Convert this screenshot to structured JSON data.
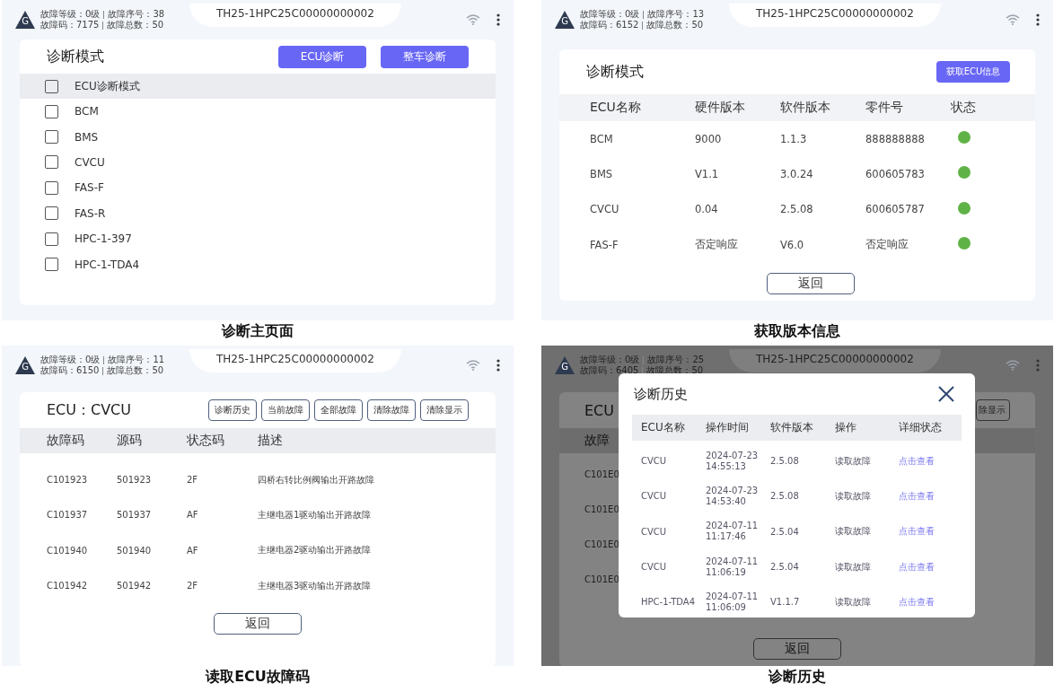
{
  "panels": [
    {
      "kind": "ecu_select",
      "caption": "诊断主页面",
      "status": {
        "logo": "G",
        "fault_level": "故障等级：0级",
        "fault_seq": "故障序号：38",
        "fault_code": "故障码：7175",
        "fault_total": "故障总数：50",
        "device": "TH25-1HPC25C00000000002"
      },
      "title": "诊断模式",
      "buttons": [
        "ECU诊断",
        "整车诊断"
      ],
      "header_checkbox": {
        "label": "ECU诊断模式",
        "checked": false
      },
      "items": [
        {
          "label": "BCM",
          "checked": false
        },
        {
          "label": "BMS",
          "checked": false
        },
        {
          "label": "CVCU",
          "checked": false
        },
        {
          "label": "FAS-F",
          "checked": false
        },
        {
          "label": "FAS-R",
          "checked": false
        },
        {
          "label": "HPC-1-397",
          "checked": false
        },
        {
          "label": "HPC-1-TDA4",
          "checked": false
        }
      ]
    },
    {
      "kind": "version_info",
      "caption": "获取版本信息",
      "status": {
        "logo": "G",
        "fault_level": "故障等级：0级",
        "fault_seq": "故障序号：13",
        "fault_code": "故障码：6152",
        "fault_total": "故障总数：50",
        "device": "TH25-1HPC25C00000000002"
      },
      "title": "诊断模式",
      "button": "获取ECU信息",
      "columns": [
        "ECU名称",
        "硬件版本",
        "软件版本",
        "零件号",
        "状态"
      ],
      "rows": [
        {
          "cells": [
            "BCM",
            "9000",
            "1.1.3",
            "888888888"
          ],
          "color": "#5fb346"
        },
        {
          "cells": [
            "BMS",
            "V1.1",
            "3.0.24",
            "600605783"
          ],
          "color": "#5fb346"
        },
        {
          "cells": [
            "CVCU",
            "0.04",
            "2.5.08",
            "600605787"
          ],
          "color": "#5fb346"
        },
        {
          "cells": [
            "FAS-F",
            "否定响应",
            "V6.0",
            "否定响应"
          ],
          "color": "#5fb346"
        }
      ],
      "back": "返回"
    },
    {
      "kind": "fault_codes",
      "caption": "读取ECU故障码",
      "status": {
        "logo": "G",
        "fault_level": "故障等级：0级",
        "fault_seq": "故障序号：11",
        "fault_code": "故障码：6150",
        "fault_total": "故障总数：50",
        "device": "TH25-1HPC25C00000000002"
      },
      "ecu": "ECU：CVCU",
      "buttons": [
        "诊断历史",
        "当前故障",
        "全部故障",
        "清除故障",
        "清除显示"
      ],
      "columns": [
        "故障码",
        "源码",
        "状态码",
        "描述"
      ],
      "rows": [
        [
          "C101923",
          "501923",
          "2F",
          "四桥右转比例阀输出开路故障"
        ],
        [
          "C101937",
          "501937",
          "AF",
          "主继电器1驱动输出开路故障"
        ],
        [
          "C101940",
          "501940",
          "AF",
          "主继电器2驱动输出开路故障"
        ],
        [
          "C101942",
          "501942",
          "2F",
          "主继电器3驱动输出开路故障"
        ]
      ],
      "back": "返回"
    },
    {
      "kind": "history",
      "caption": "诊断历史",
      "status": {
        "logo": "G",
        "fault_level": "故障等级：0级",
        "fault_seq": "故障序号：25",
        "fault_code": "故障码：6405",
        "fault_total": "故障总数：50",
        "device": "TH25-1HPC25C00000000002"
      },
      "underlay": {
        "ecu": "ECU",
        "button": "除显示",
        "header": "故障",
        "codes": [
          "C101E0",
          "C101E0",
          "C101E0",
          "C101E0"
        ],
        "back": "返回"
      },
      "dialog": {
        "title": "诊断历史",
        "columns": [
          "ECU名称",
          "操作时间",
          "软件版本",
          "操作",
          "详细状态"
        ],
        "rows": [
          {
            "ecu": "CVCU",
            "date": "2024-07-23",
            "time": "14:55:13",
            "version": "2.5.08",
            "action": "读取故障",
            "link": "点击查看"
          },
          {
            "ecu": "CVCU",
            "date": "2024-07-23",
            "time": "14:53:40",
            "version": "2.5.08",
            "action": "读取故障",
            "link": "点击查看"
          },
          {
            "ecu": "CVCU",
            "date": "2024-07-11",
            "time": "11:17:46",
            "version": "2.5.04",
            "action": "读取故障",
            "link": "点击查看"
          },
          {
            "ecu": "CVCU",
            "date": "2024-07-11",
            "time": "11:06:19",
            "version": "2.5.04",
            "action": "读取故障",
            "link": "点击查看"
          },
          {
            "ecu": "HPC-1-TDA4",
            "date": "2024-07-11",
            "time": "11:06:09",
            "version": "V1.1.7",
            "action": "读取故障",
            "link": "点击查看"
          }
        ]
      }
    }
  ]
}
